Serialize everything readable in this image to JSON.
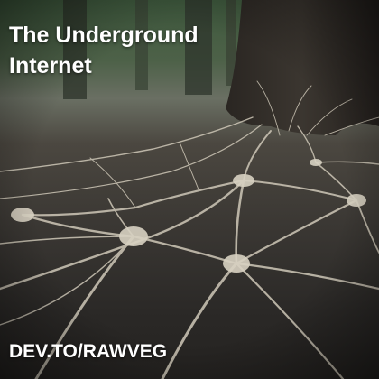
{
  "card": {
    "title": "The Underground Internet",
    "footer": "DEV.TO/RAWVEG"
  },
  "colors": {
    "text": "#ffffff",
    "forest": "#4d6148",
    "soil": "#3a3733",
    "root": "#cfc8b8"
  },
  "image": {
    "subject": "tree-roots-network-illustration"
  }
}
